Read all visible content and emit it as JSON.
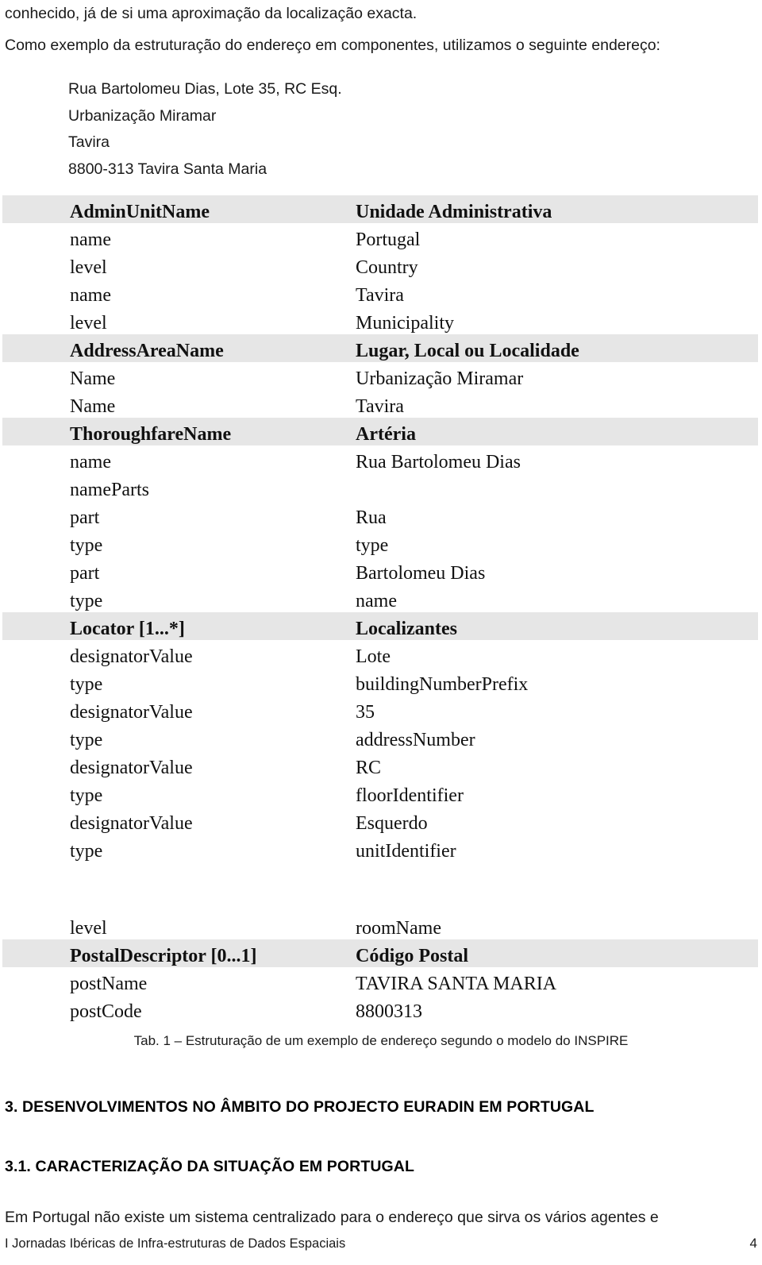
{
  "document": {
    "intro_paragraph": "conhecido, já de si uma aproximação da localização exacta.",
    "example_paragraph": "Como exemplo da estruturação do endereço em componentes, utilizamos o seguinte endereço:",
    "address_example": [
      "Rua Bartolomeu Dias, Lote 35, RC Esq.",
      "Urbanização Miramar",
      "Tavira",
      "8800-313 Tavira Santa Maria"
    ]
  },
  "table": {
    "caption": "Tab. 1 – Estruturação de um exemplo de endereço segundo o modelo do INSPIRE",
    "rows": [
      {
        "key": "AdminUnitName",
        "value": "Unidade Administrativa",
        "shaded": true
      },
      {
        "key": "name",
        "value": "Portugal",
        "shaded": false
      },
      {
        "key": "level",
        "value": "Country",
        "shaded": false
      },
      {
        "key": "name",
        "value": "Tavira",
        "shaded": false
      },
      {
        "key": "level",
        "value": "Municipality",
        "shaded": false
      },
      {
        "key": "AddressAreaName",
        "value": "Lugar, Local ou Localidade",
        "shaded": true
      },
      {
        "key": "Name",
        "value": "Urbanização Miramar",
        "shaded": false
      },
      {
        "key": "Name",
        "value": "Tavira",
        "shaded": false
      },
      {
        "key": "ThoroughfareName",
        "value": "Artéria",
        "shaded": true
      },
      {
        "key": "name",
        "value": "Rua Bartolomeu Dias",
        "shaded": false
      },
      {
        "key": "nameParts",
        "value": "",
        "shaded": false
      },
      {
        "key": "part",
        "value": "Rua",
        "shaded": false
      },
      {
        "key": "type",
        "value": "type",
        "shaded": false
      },
      {
        "key": "part",
        "value": "Bartolomeu Dias",
        "shaded": false
      },
      {
        "key": "type",
        "value": "name",
        "shaded": false
      },
      {
        "key": "Locator [1...*]",
        "value": "Localizantes",
        "shaded": true
      },
      {
        "key": "designatorValue",
        "value": "Lote",
        "shaded": false
      },
      {
        "key": "type",
        "value": "buildingNumberPrefix",
        "shaded": false
      },
      {
        "key": "designatorValue",
        "value": "35",
        "shaded": false
      },
      {
        "key": "type",
        "value": "addressNumber",
        "shaded": false
      },
      {
        "key": "designatorValue",
        "value": "RC",
        "shaded": false
      },
      {
        "key": "type",
        "value": "floorIdentifier",
        "shaded": false
      },
      {
        "key": "designatorValue",
        "value": "Esquerdo",
        "shaded": false
      },
      {
        "key": "type",
        "value": "unitIdentifier",
        "shaded": false
      },
      {
        "key": "",
        "value": "",
        "shaded": false,
        "gap": true
      },
      {
        "key": "level",
        "value": "roomName",
        "shaded": false
      },
      {
        "key": "PostalDescriptor [0...1]",
        "value": "Código Postal",
        "shaded": true
      },
      {
        "key": "postName",
        "value": "TAVIRA SANTA MARIA",
        "shaded": false
      },
      {
        "key": "postCode",
        "value": "8800313",
        "shaded": false
      }
    ]
  },
  "sections": {
    "heading_1": "3. DESENVOLVIMENTOS NO ÂMBITO DO PROJECTO EURADIN EM PORTUGAL",
    "heading_2": "3.1. CARACTERIZAÇÃO DA SITUAÇÃO EM PORTUGAL",
    "body_paragraph": "Em Portugal não existe um sistema centralizado para o endereço que sirva os vários agentes e"
  },
  "footer": {
    "text": "I Jornadas Ibéricas de Infra-estruturas de Dados Espaciais",
    "page_number": "4"
  },
  "colors": {
    "shaded_row": "#e6e6e6",
    "text": "#111111",
    "background": "#ffffff"
  }
}
